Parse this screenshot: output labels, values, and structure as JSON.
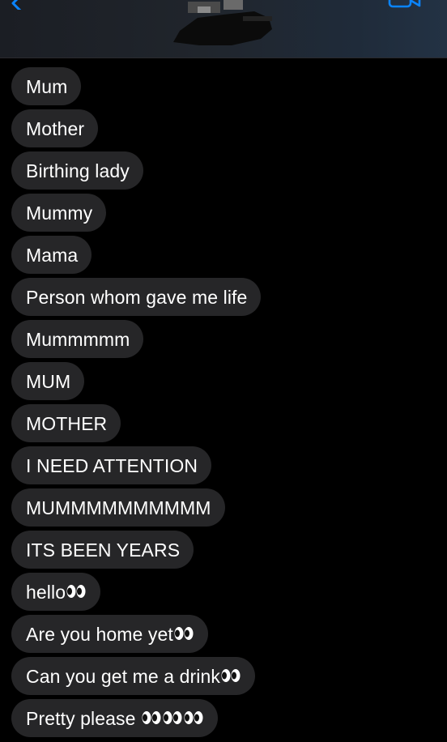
{
  "header": {
    "back_icon": "chevron-left-icon",
    "video_icon": "video-camera-icon",
    "accent_color": "#0a84ff"
  },
  "messages": [
    {
      "text": "Mum",
      "eyes": 0
    },
    {
      "text": "Mother",
      "eyes": 0
    },
    {
      "text": "Birthing lady",
      "eyes": 0
    },
    {
      "text": "Mummy",
      "eyes": 0
    },
    {
      "text": "Mama",
      "eyes": 0
    },
    {
      "text": "Person whom gave me life",
      "eyes": 0
    },
    {
      "text": "Mummmmm",
      "eyes": 0
    },
    {
      "text": "MUM",
      "eyes": 0
    },
    {
      "text": "MOTHER",
      "eyes": 0
    },
    {
      "text": "I NEED ATTENTION",
      "eyes": 0
    },
    {
      "text": "MUMMMMMMMMMM",
      "eyes": 0
    },
    {
      "text": "ITS BEEN YEARS",
      "eyes": 0
    },
    {
      "text": "hello",
      "eyes": 1
    },
    {
      "text": "Are you home yet",
      "eyes": 1
    },
    {
      "text": "Can you get me a drink",
      "eyes": 1
    },
    {
      "text": "Pretty please ",
      "eyes": 3
    }
  ],
  "colors": {
    "background": "#000000",
    "bubble": "#262628",
    "text": "#ffffff"
  }
}
